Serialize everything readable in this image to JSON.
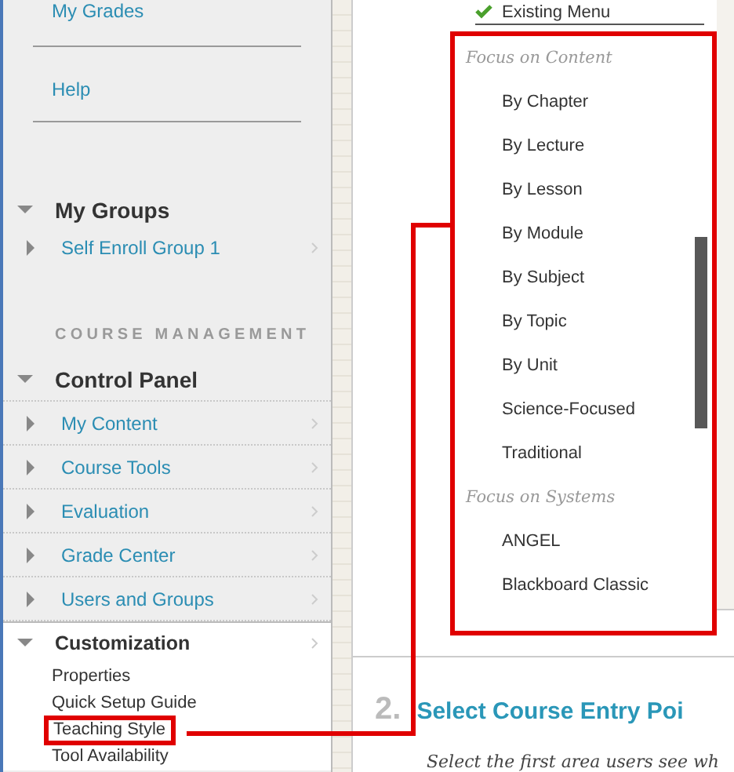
{
  "sidebar": {
    "links": [
      {
        "label": "My Grades"
      },
      {
        "label": "Help"
      }
    ],
    "my_groups": {
      "title": "My Groups",
      "expanded": true,
      "items": [
        {
          "label": "Self Enroll Group 1",
          "expanded": false
        }
      ]
    },
    "section_label": "COURSE MANAGEMENT",
    "control_panel": {
      "title": "Control Panel",
      "expanded": true,
      "items": [
        {
          "label": "My Content",
          "expanded": false
        },
        {
          "label": "Course Tools",
          "expanded": false
        },
        {
          "label": "Evaluation",
          "expanded": false
        },
        {
          "label": "Grade Center",
          "expanded": false
        },
        {
          "label": "Users and Groups",
          "expanded": false
        },
        {
          "label": "Customization",
          "expanded": true,
          "children": [
            {
              "label": "Properties",
              "highlighted": false
            },
            {
              "label": "Quick Setup Guide",
              "highlighted": false
            },
            {
              "label": "Teaching Style",
              "highlighted": true
            },
            {
              "label": "Tool Availability",
              "highlighted": false
            }
          ]
        }
      ]
    }
  },
  "main": {
    "existing_menu": "Existing Menu",
    "menu_groups": [
      {
        "heading": "Focus on Content",
        "items": [
          "By Chapter",
          "By Lecture",
          "By Lesson",
          "By Module",
          "By Subject",
          "By Topic",
          "By Unit",
          "Science-Focused",
          "Traditional"
        ]
      },
      {
        "heading": "Focus on Systems",
        "items": [
          "ANGEL",
          "Blackboard Classic"
        ]
      }
    ],
    "step": {
      "number": "2.",
      "title": "Select Course Entry Poi",
      "description": "Select the first area users see wh"
    }
  }
}
